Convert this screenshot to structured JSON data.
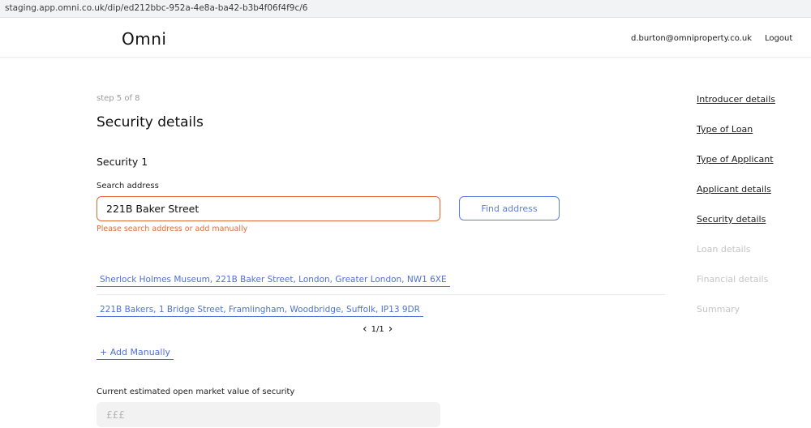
{
  "browser": {
    "url": "staging.app.omni.co.uk/dip/ed212bbc-952a-4e8a-ba42-b3b4f06f4f9c/6"
  },
  "header": {
    "logo": "Omni",
    "user_email": "d.burton@omniproperty.co.uk",
    "logout_label": "Logout"
  },
  "form": {
    "step": "step 5 of 8",
    "title": "Security details",
    "section_title": "Security 1",
    "search": {
      "label": "Search address",
      "value": "221B Baker Street",
      "error": "Please search address or add manually",
      "find_button_label": "Find address"
    },
    "results": [
      "Sherlock Holmes Museum, 221B Baker Street, London, Greater London, NW1 6XE",
      "221B Bakers, 1 Bridge Street, Framlingham, Woodbridge, Suffolk, IP13 9DR"
    ],
    "pager": {
      "prev_icon": "chevron-left-icon",
      "text": "1/1",
      "next_icon": "chevron-right-icon"
    },
    "add_manually_label": "+ Add Manually",
    "market_value": {
      "label": "Current estimated open market value of security",
      "placeholder": "£££"
    }
  },
  "sidebar": {
    "items": [
      {
        "label": "Introducer details",
        "state": "completed"
      },
      {
        "label": "Type of Loan",
        "state": "completed"
      },
      {
        "label": "Type of Applicant",
        "state": "completed"
      },
      {
        "label": "Applicant details",
        "state": "completed"
      },
      {
        "label": "Security details",
        "state": "current"
      },
      {
        "label": "Loan details",
        "state": "disabled"
      },
      {
        "label": "Financial details",
        "state": "disabled"
      },
      {
        "label": "Summary",
        "state": "disabled"
      }
    ]
  },
  "colors": {
    "error": "#e06a3a",
    "accent": "#4f71d6",
    "disabled": "#c4c4c4"
  }
}
